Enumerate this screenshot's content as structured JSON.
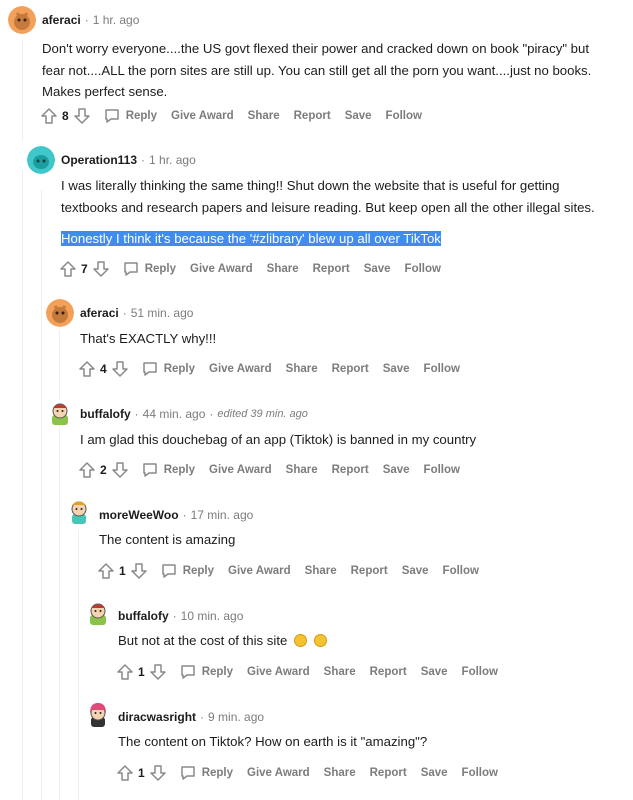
{
  "actions": {
    "reply": "Reply",
    "give_award": "Give Award",
    "share": "Share",
    "report": "Report",
    "save": "Save",
    "follow": "Follow"
  },
  "comments": [
    {
      "username": "aferaci",
      "time": "1 hr. ago",
      "body_lines": [
        "Don't worry everyone....the US govt flexed their power and cracked down on book \"piracy\" but",
        "fear not....ALL the porn sites are still up. You can still get all the porn you want....just no books.",
        "Makes perfect sense."
      ],
      "votes": "8",
      "avatar_color": "#f2a05a"
    },
    {
      "username": "Operation113",
      "time": "1 hr. ago",
      "body_lines": [
        "I was literally thinking the same thing!! Shut down the website that is useful for getting",
        "textbooks and research papers and leisure reading. But keep open all the other illegal sites."
      ],
      "highlighted_line": "Honestly I think it's because the '#zlibrary' blew up all over TikTok",
      "votes": "7",
      "avatar_color": "#3fc7c9"
    },
    {
      "username": "aferaci",
      "time": "51 min. ago",
      "body_lines": [
        "That's EXACTLY why!!!"
      ],
      "votes": "4",
      "avatar_color": "#f2a05a"
    },
    {
      "username": "buffalofy",
      "time": "44 min. ago",
      "edited": "edited 39 min. ago",
      "body_lines": [
        "I am glad this douchebag of an app (Tiktok) is banned in my country"
      ],
      "votes": "2",
      "avatar_color": "#8bc34a"
    },
    {
      "username": "moreWeeWoo",
      "time": "17 min. ago",
      "body_lines": [
        "The content is amazing"
      ],
      "votes": "1",
      "avatar_color": "#46c6b6"
    },
    {
      "username": "buffalofy",
      "time": "10 min. ago",
      "body_lines": [
        "But not at the cost of this site"
      ],
      "votes": "1",
      "avatar_color": "#8bc34a"
    },
    {
      "username": "diracwasright",
      "time": "9 min. ago",
      "body_lines": [
        "The content on Tiktok? How on earth is it \"amazing\"?"
      ],
      "votes": "1",
      "avatar_color": "#e04a7a"
    }
  ]
}
